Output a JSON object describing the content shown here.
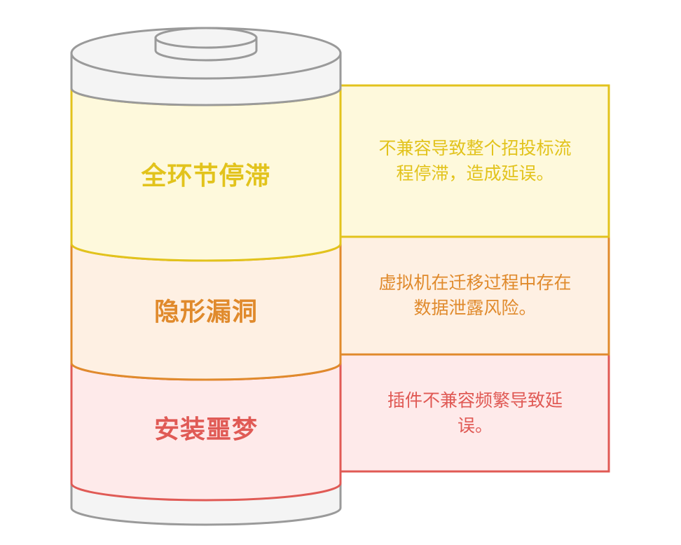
{
  "segments": [
    {
      "title": "全环节停滞",
      "description": "不兼容导致整个招投标流程停滞，造成延误。",
      "stroke": "#E2C31C",
      "fill": "#FEF9DC",
      "text_color": "#E2C31C"
    },
    {
      "title": "隐形漏洞",
      "description": "虚拟机在迁移过程中存在数据泄露风险。",
      "stroke": "#E08A2C",
      "fill": "#FEF0E3",
      "text_color": "#E08A2C"
    },
    {
      "title": "安装噩梦",
      "description": "插件不兼容频繁导致延误。",
      "stroke": "#E05A55",
      "fill": "#FEEAEA",
      "text_color": "#E05A55"
    }
  ],
  "battery": {
    "body_stroke": "#9A9A9A",
    "body_fill": "#F4F4F4"
  }
}
